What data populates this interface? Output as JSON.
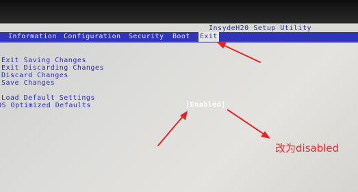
{
  "bios": {
    "title": "InsydeH20 Setup Utility",
    "menu": [
      "Information",
      "Configuration",
      "Security",
      "Boot",
      "Exit"
    ],
    "active_menu": "Exit",
    "options": [
      "Exit Saving Changes",
      "Exit Discarding Changes",
      "Discard Changes",
      "Save Changes",
      "Load Default Settings",
      "OS Optimized Defaults"
    ],
    "os_optimized_value": "[Enabled]"
  },
  "annotation": {
    "text": "改为disabled",
    "color": "#ff2020"
  },
  "colors": {
    "menubar": "#2f34b8",
    "option_text": "#2b2bbf",
    "arrow": "#e8231f"
  }
}
